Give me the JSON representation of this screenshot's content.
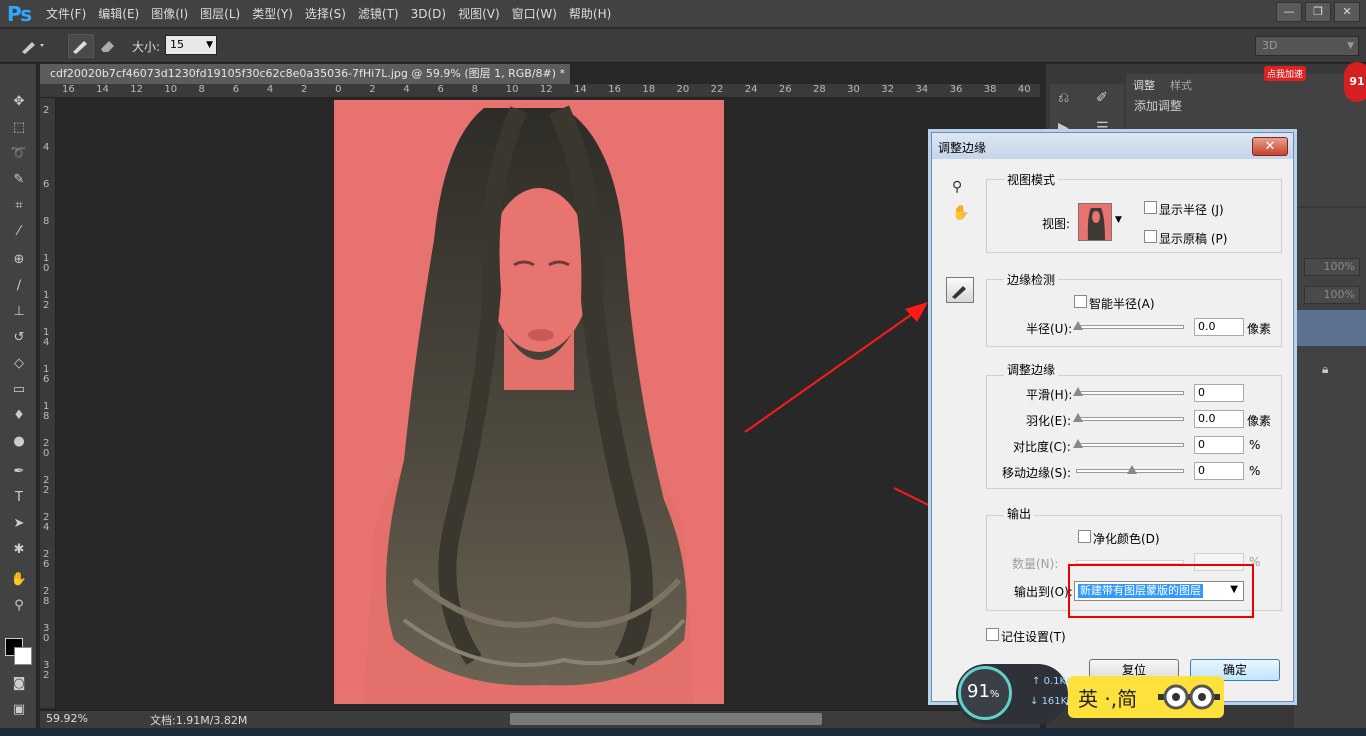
{
  "app": {
    "logo": "Ps",
    "menu": [
      "文件(F)",
      "编辑(E)",
      "图像(I)",
      "图层(L)",
      "类型(Y)",
      "选择(S)",
      "滤镜(T)",
      "3D(D)",
      "视图(V)",
      "窗口(W)",
      "帮助(H)"
    ],
    "window_controls": [
      "—",
      "❐",
      "✕"
    ]
  },
  "options_bar": {
    "size_label": "大小:",
    "size_value": "15",
    "workspace": "3D"
  },
  "document": {
    "tab_title": "cdf20020b7cf46073d1230fd19105f30c62c8e0a35036-7fHi7L.jpg @ 59.9% (图层 1, RGB/8#) *",
    "ruler_h": [
      "16",
      "14",
      "12",
      "10",
      "8",
      "6",
      "4",
      "2",
      "0",
      "2",
      "4",
      "6",
      "8",
      "10",
      "12",
      "14",
      "16",
      "18",
      "20",
      "22",
      "24",
      "26",
      "28",
      "30",
      "32",
      "34",
      "36",
      "38",
      "40"
    ],
    "ruler_v": [
      "2",
      "4",
      "6",
      "8",
      "10",
      "12",
      "14",
      "16",
      "18",
      "20",
      "22",
      "24",
      "26",
      "28",
      "30",
      "32"
    ],
    "zoom": "59.92%",
    "doc_size": "文档:1.91M/3.82M"
  },
  "right_panel": {
    "tab_adjust": "调整",
    "tab_styles": "样式",
    "adjust_add": "添加调整",
    "opacity1": "100%",
    "opacity2": "100%"
  },
  "dialog": {
    "title": "调整边缘",
    "close": "✕",
    "view_mode": {
      "title": "视图模式",
      "view_label": "视图:",
      "show_radius": "显示半径 (J)",
      "show_original": "显示原稿 (P)"
    },
    "edge_detection": {
      "title": "边缘检测",
      "smart_radius": "智能半径(A)",
      "radius_label": "半径(U):",
      "radius_value": "0.0",
      "radius_unit": "像素"
    },
    "adjust_edge": {
      "title": "调整边缘",
      "smooth_label": "平滑(H):",
      "smooth_value": "0",
      "feather_label": "羽化(E):",
      "feather_value": "0.0",
      "feather_unit": "像素",
      "contrast_label": "对比度(C):",
      "contrast_value": "0",
      "contrast_unit": "%",
      "shift_label": "移动边缘(S):",
      "shift_value": "0",
      "shift_unit": "%"
    },
    "output": {
      "title": "输出",
      "decontaminate": "净化颜色(D)",
      "amount_label": "数量(N):",
      "amount_unit": "%",
      "output_to_label": "输出到(O):",
      "output_to_value": "新建带有图层蒙版的图层"
    },
    "remember": "记住设置(T)",
    "reset_button": "复位",
    "ok_button": "确定"
  },
  "overlays": {
    "speed_percent": "91",
    "speed_percent_sign": "%",
    "upload": "0.1K/s",
    "download": "161K/s",
    "ime": "英 ·,简",
    "ad_label": "点我加速",
    "ad_number": "91"
  },
  "colors": {
    "canvas_bg": "#e8726f",
    "hair": "#4a463c",
    "arrow": "#ff1a1a",
    "selection": "#3399ff"
  }
}
